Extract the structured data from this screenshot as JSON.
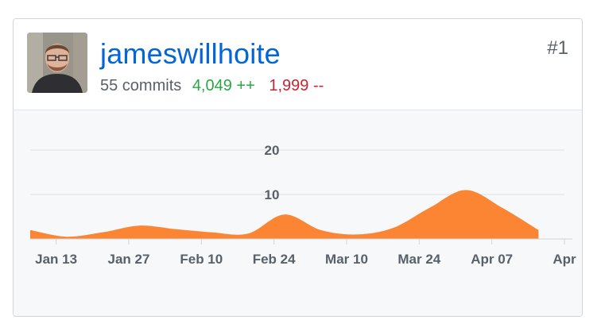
{
  "contributor": {
    "username": "jameswillhoite",
    "commits": "55 commits",
    "additions": "4,049 ++",
    "deletions": "1,999 --",
    "rank": "#1"
  },
  "colors": {
    "link": "#0366d6",
    "additions": "#28a745",
    "deletions": "#cb2431",
    "area": "#fb8532",
    "graph_bg": "#f6f8fa"
  },
  "chart_data": {
    "type": "area",
    "ylim": [
      0,
      20
    ],
    "yticks": [
      {
        "value": 20,
        "label": "20"
      },
      {
        "value": 10,
        "label": "10"
      }
    ],
    "xrange": [
      "2019-01-08",
      "2019-04-21"
    ],
    "xticks": [
      {
        "date": "2019-01-13",
        "label": "Jan 13"
      },
      {
        "date": "2019-01-27",
        "label": "Jan 27"
      },
      {
        "date": "2019-02-10",
        "label": "Feb 10"
      },
      {
        "date": "2019-02-24",
        "label": "Feb 24"
      },
      {
        "date": "2019-03-10",
        "label": "Mar 10"
      },
      {
        "date": "2019-03-24",
        "label": "Mar 24"
      },
      {
        "date": "2019-04-07",
        "label": "Apr 07"
      },
      {
        "date": "2019-04-21",
        "label": "Apr"
      }
    ],
    "x": [
      "2019-01-08",
      "2019-01-15",
      "2019-01-22",
      "2019-01-29",
      "2019-02-05",
      "2019-02-12",
      "2019-02-19",
      "2019-02-26",
      "2019-03-05",
      "2019-03-12",
      "2019-03-19",
      "2019-03-26",
      "2019-04-02",
      "2019-04-09",
      "2019-04-16"
    ],
    "values": [
      2,
      0.5,
      1.5,
      3,
      2.2,
      1.5,
      1.2,
      5.5,
      2,
      1,
      2.5,
      7,
      11,
      7,
      2
    ],
    "grid": true
  }
}
